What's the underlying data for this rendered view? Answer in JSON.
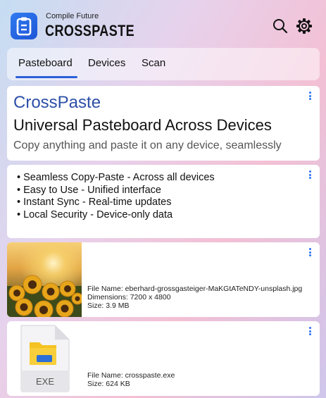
{
  "header": {
    "tagline": "Compile Future",
    "brand": "CROSSPASTE",
    "search_icon": "search-icon",
    "settings_icon": "gear-icon"
  },
  "tabs": [
    {
      "label": "Pasteboard",
      "active": true
    },
    {
      "label": "Devices",
      "active": false
    },
    {
      "label": "Scan",
      "active": false
    }
  ],
  "cards": {
    "intro": {
      "title": "CrossPaste",
      "subtitle": "Universal Pasteboard Across Devices",
      "description": "Copy anything and paste it on any device, seamlessly"
    },
    "features": [
      "Seamless Copy-Paste - Across all devices",
      "Easy to Use - Unified interface",
      "Instant Sync - Real-time updates",
      "Local Security - Device-only data"
    ],
    "image_file": {
      "file_name": "File Name: eberhard-grossgasteiger-MaKGtATeNDY-unsplash.jpg",
      "dimensions": "Dimensions: 7200 x 4800",
      "size": "Size: 3.9 MB"
    },
    "exe_file": {
      "icon_label": "EXE",
      "file_name": "File Name: crosspaste.exe",
      "size": "Size: 624 KB"
    }
  },
  "colors": {
    "accent": "#2b5fd9",
    "title_blue": "#2d4fa8",
    "menu_dots": "#2b6ff0"
  }
}
